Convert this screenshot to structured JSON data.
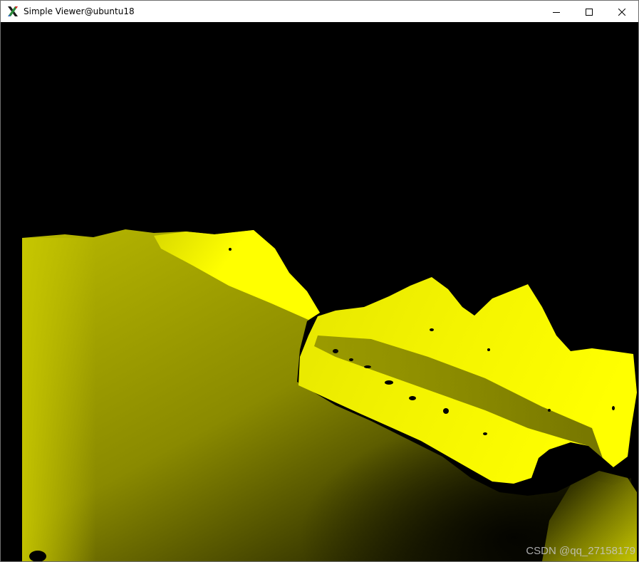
{
  "window": {
    "title": "Simple Viewer@ubuntu18",
    "app_icon": "x11-icon",
    "controls": {
      "minimize_icon": "minimize-icon",
      "maximize_icon": "maximize-icon",
      "close_icon": "close-icon"
    }
  },
  "viewer": {
    "image_type": "depth-map",
    "colors": {
      "bright": "#ffff00",
      "mid": "#a8a800",
      "dark": "#000000"
    }
  },
  "watermark": {
    "text": "CSDN @qq_27158179"
  }
}
